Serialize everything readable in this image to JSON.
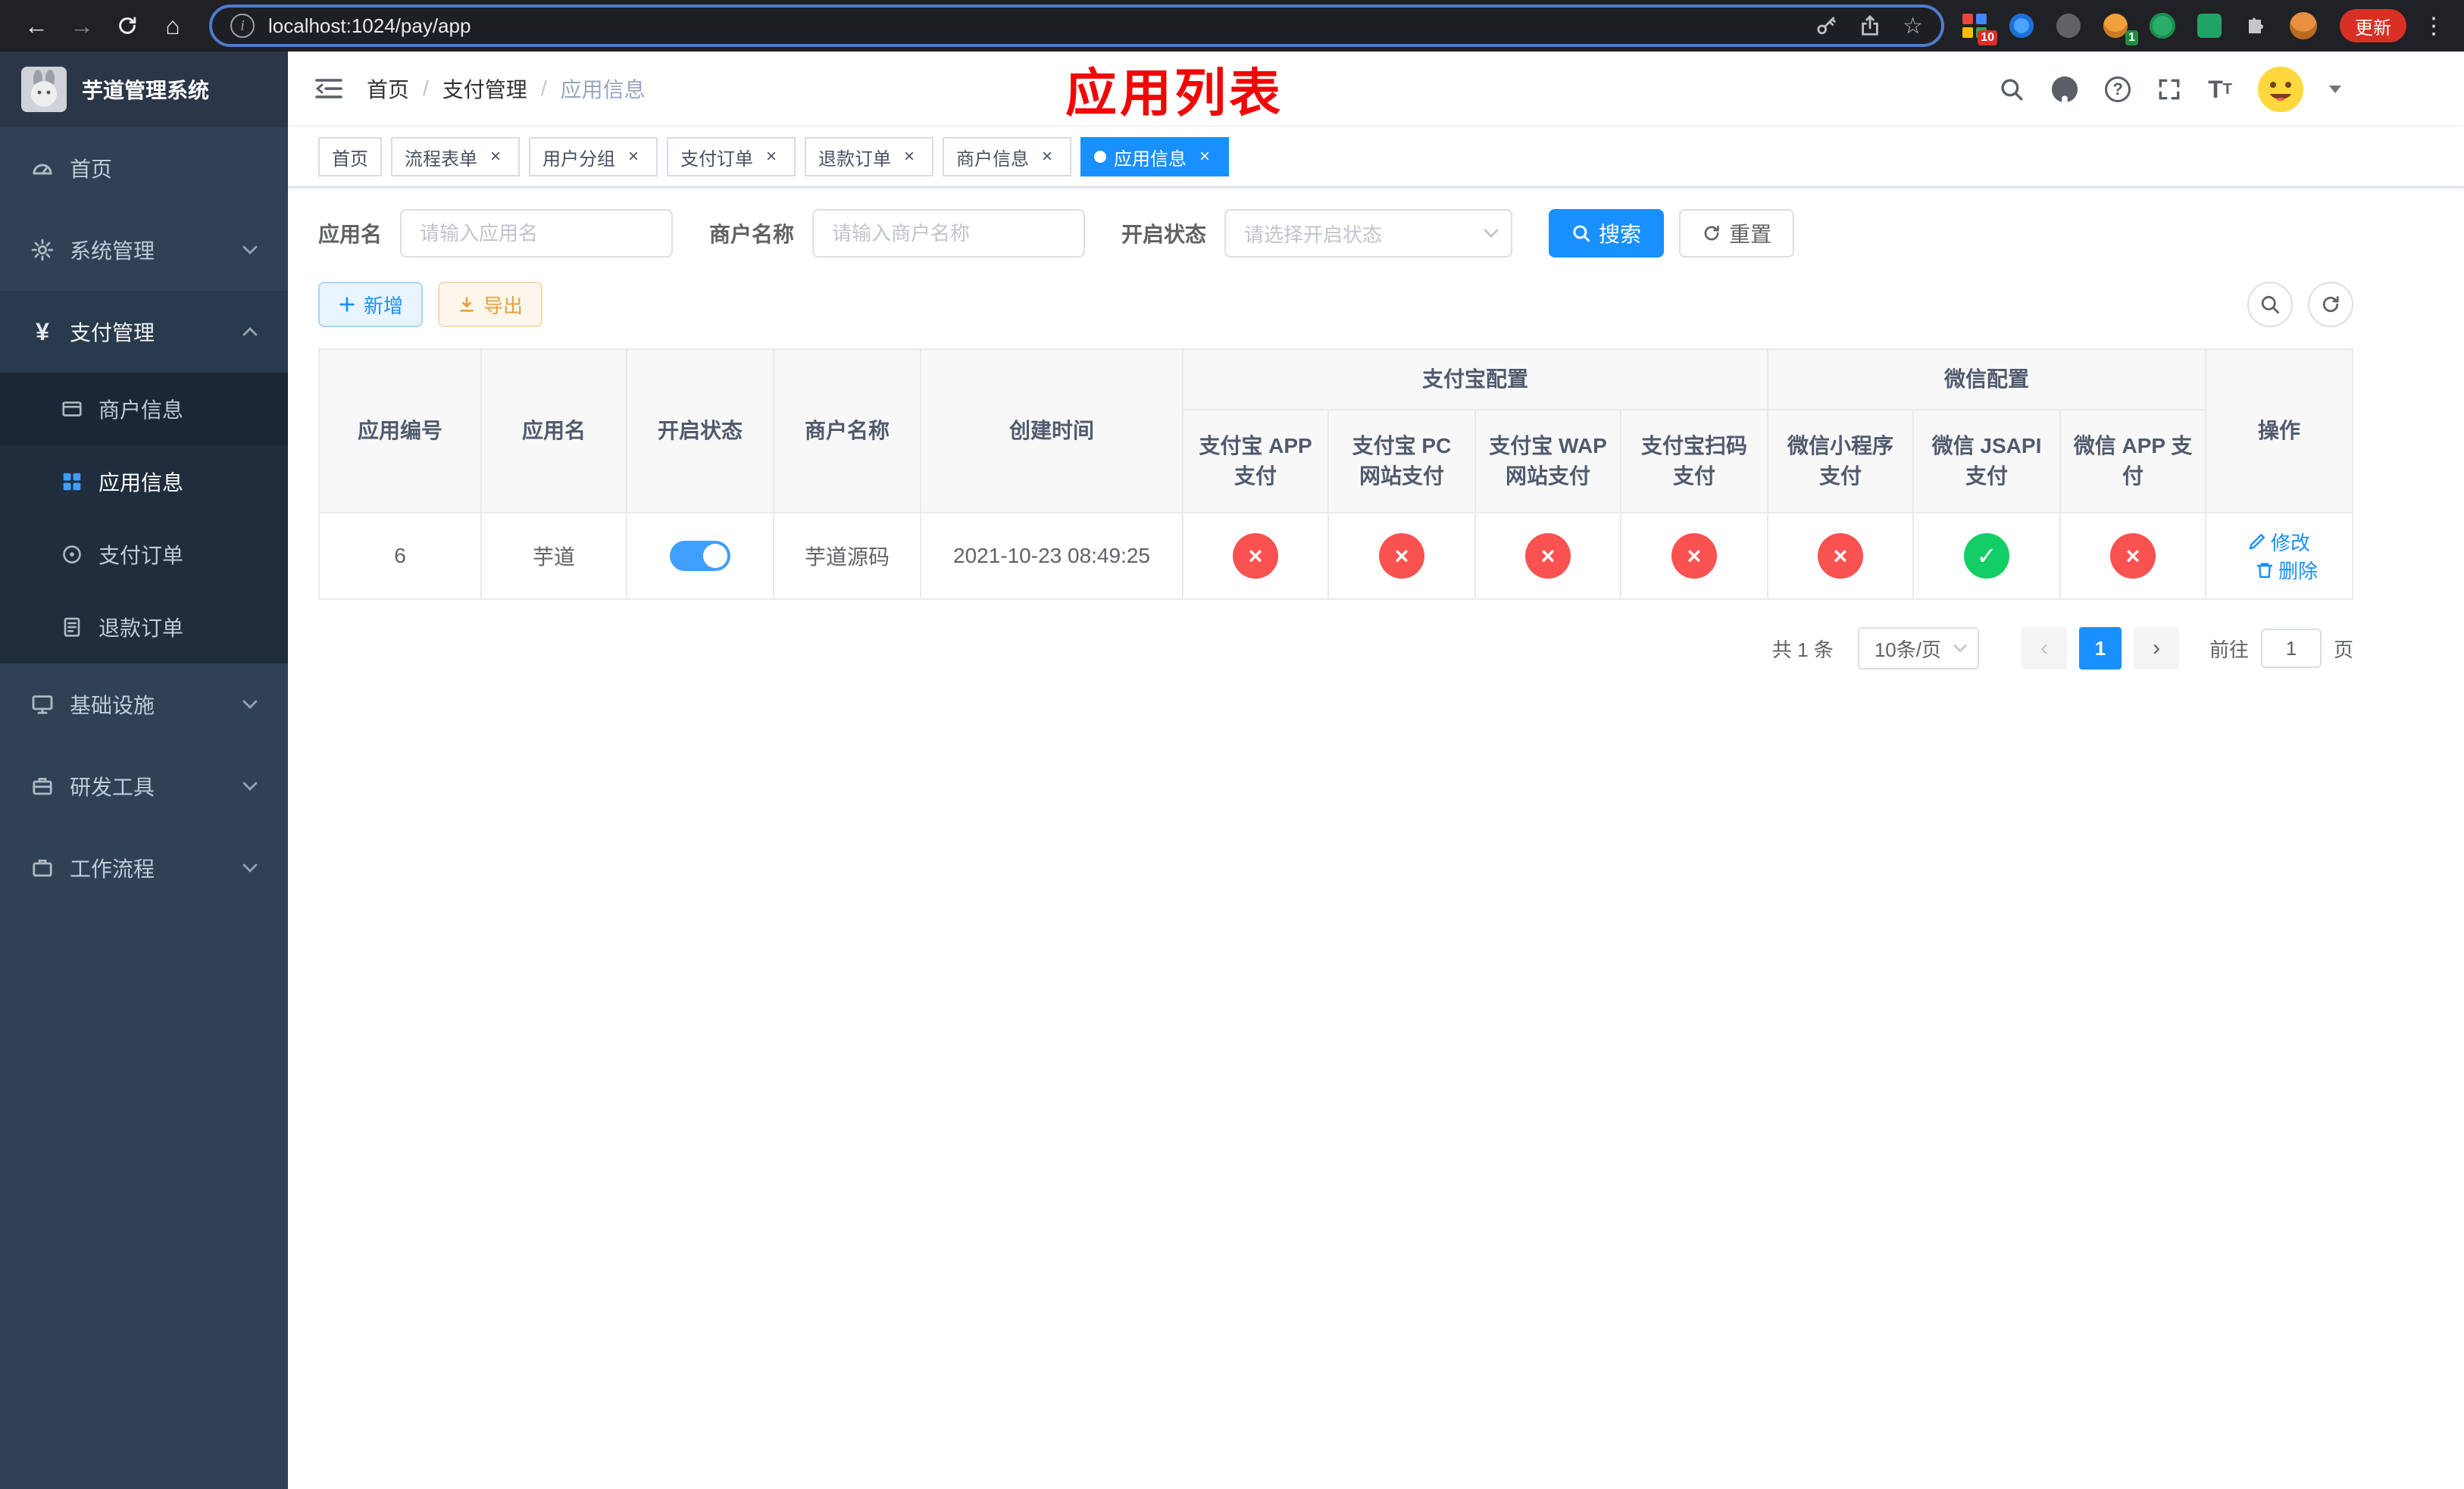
{
  "colors": {
    "accent": "#1890ff",
    "toggle_on": "#409eff",
    "success": "#13ce66",
    "danger": "#fa5151",
    "warning": "#e6a23c",
    "sidebar_bg": "#304156",
    "annotation_red": "#f20505"
  },
  "browser": {
    "url": "localhost:1024/pay/app",
    "update_label": "更新",
    "ext_badge_grid": "10",
    "ext_badge_avatar": "1"
  },
  "sidebar": {
    "title": "芋道管理系统",
    "items": [
      {
        "label": "首页"
      },
      {
        "label": "系统管理"
      },
      {
        "label": "支付管理",
        "children": [
          {
            "label": "商户信息"
          },
          {
            "label": "应用信息"
          },
          {
            "label": "支付订单"
          },
          {
            "label": "退款订单"
          }
        ]
      },
      {
        "label": "基础设施"
      },
      {
        "label": "研发工具"
      },
      {
        "label": "工作流程"
      }
    ]
  },
  "header": {
    "breadcrumb": [
      "首页",
      "支付管理",
      "应用信息"
    ],
    "annotation": "应用列表"
  },
  "tabs": [
    {
      "label": "首页"
    },
    {
      "label": "流程表单"
    },
    {
      "label": "用户分组"
    },
    {
      "label": "支付订单"
    },
    {
      "label": "退款订单"
    },
    {
      "label": "商户信息"
    },
    {
      "label": "应用信息"
    }
  ],
  "filters": {
    "app_name_label": "应用名",
    "app_name_placeholder": "请输入应用名",
    "merchant_label": "商户名称",
    "merchant_placeholder": "请输入商户名称",
    "status_label": "开启状态",
    "status_placeholder": "请选择开启状态",
    "search_label": "搜索",
    "reset_label": "重置"
  },
  "toolbar": {
    "add_label": "新增",
    "export_label": "导出"
  },
  "table": {
    "headers": {
      "id": "应用编号",
      "name": "应用名",
      "status": "开启状态",
      "merchant": "商户名称",
      "created": "创建时间",
      "alipay_group": "支付宝配置",
      "wechat_group": "微信配置",
      "alipay_app": "支付宝 APP 支付",
      "alipay_pc": "支付宝 PC 网站支付",
      "alipay_wap": "支付宝 WAP 网站支付",
      "alipay_qr": "支付宝扫码支付",
      "wechat_mini": "微信小程序支付",
      "wechat_jsapi": "微信 JSAPI 支付",
      "wechat_app": "微信 APP 支付",
      "actions": "操作"
    },
    "rows": [
      {
        "id": "6",
        "name": "芋道",
        "status_on": true,
        "merchant": "芋道源码",
        "created": "2021-10-23 08:49:25",
        "alipay_app": "no",
        "alipay_pc": "no",
        "alipay_wap": "no",
        "alipay_qr": "no",
        "wechat_mini": "no",
        "wechat_jsapi": "yes",
        "wechat_app": "no",
        "edit_label": "修改",
        "delete_label": "删除"
      }
    ]
  },
  "pagination": {
    "total_label": "共 1 条",
    "page_size_label": "10条/页",
    "current_page": "1",
    "goto_prefix": "前往",
    "goto_value": "1",
    "goto_suffix": "页"
  }
}
